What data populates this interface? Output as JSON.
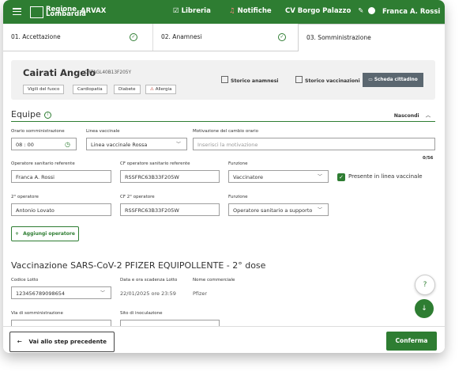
{
  "topbar": {
    "logo_text_1": "Regione",
    "logo_text_2": "Lombardia",
    "app_name": "ARVAX",
    "libreria": "Libreria",
    "notifiche": "Notifiche",
    "centro": "CV Borgo Palazzo",
    "user": "Franca A. Rossi"
  },
  "steps": [
    {
      "label": "01. Accettazione"
    },
    {
      "label": "02. Anamnesi"
    },
    {
      "label": "03. Somministrazione"
    }
  ],
  "patient": {
    "name": "Cairati Angelo",
    "cf": "CRTAGL40B13F205Y",
    "tags": [
      "Vigili del fuoco",
      "Cardiopatia",
      "Diabete",
      "Allergia"
    ],
    "storico_anamnesi": "Storico anamnesi",
    "storico_vaccinazioni": "Storico vaccinazioni",
    "scheda_cittadino": "Scheda cittadino"
  },
  "equipe": {
    "title": "Equipe",
    "hide_label": "Nascondi",
    "orario_label": "Orario somministrazione",
    "orario_value": "08 : 00",
    "linea_label": "Linea vaccinale",
    "linea_value": "Linea vaccinale Rossa",
    "motivazione_label": "Motivazione del cambio orario",
    "motivazione_placeholder": "Inserisci la motivazione",
    "motivazione_counter": "0/56",
    "op1_label": "Operatore sanitario referente",
    "op1_value": "Franca A. Rossi",
    "cf1_label": "CF operatore sanitario referente",
    "cf1_value": "RSSFRC63B33F205W",
    "funz1_label": "Funzione",
    "funz1_value": "Vaccinatore",
    "presente_label": "Presente in linea vaccinale",
    "op2_label": "2° operatore",
    "op2_value": "Antonio Lovato",
    "cf2_label": "CF 2° operatore",
    "cf2_value": "RSSFRC63B33F205W",
    "funz2_label": "Funzione",
    "funz2_value": "Operatore sanitario a supporto",
    "add_label": "Aggiungi operatore"
  },
  "vaccinazione": {
    "title": "Vaccinazione SARS-CoV-2 PFIZER EQUIPOLLENTE - 2° dose",
    "lotto_label": "Codice Lotto",
    "lotto_value": "123456789098654",
    "scadenza_label": "Data e ora scadenza Lotto",
    "scadenza_value": "22/01/2025 ore 23:59",
    "nome_label": "Nome commerciale",
    "nome_value": "Pfizer",
    "via_label": "Via di somministrazione",
    "sito_label": "Sito di inoculazione"
  },
  "footer": {
    "prev_label": "Vai allo step precedente",
    "confirm_label": "Conferma"
  }
}
